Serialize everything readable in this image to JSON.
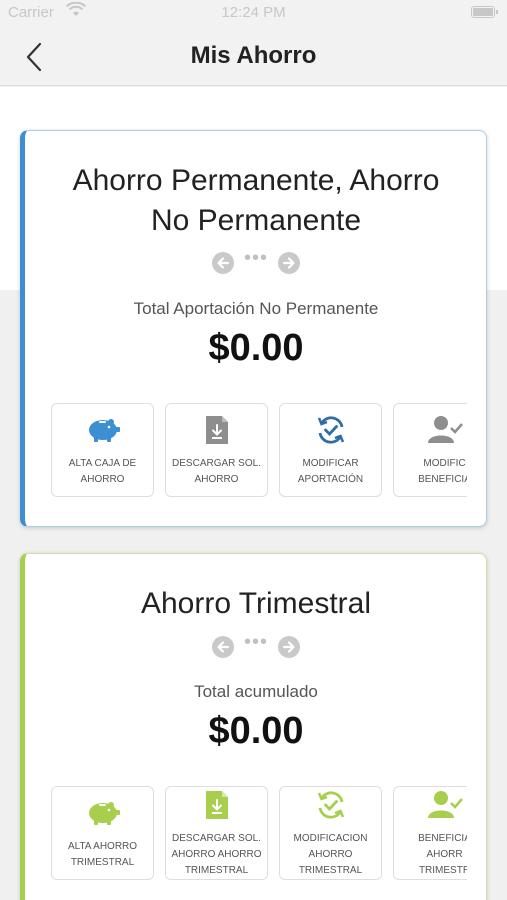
{
  "statusbar": {
    "carrier": "Carrier",
    "time": "12:24 PM"
  },
  "navbar": {
    "title": "Mis Ahorro"
  },
  "colors": {
    "blue_accent": "#3c8fd2",
    "green_accent": "#a7cf4d"
  },
  "cards": [
    {
      "title_line1": "Ahorro Permanente, Ahorro",
      "title_line2": "No Permanente",
      "label": "Total Aportación No Permanente",
      "amount": "$0.00",
      "actions": [
        {
          "icon": "piggy-bank-icon",
          "line1": "ALTA CAJA DE",
          "line2": "AHORRO",
          "line3": ""
        },
        {
          "icon": "download-document-icon",
          "line1": "DESCARGAR SOL.",
          "line2": "AHORRO",
          "line3": ""
        },
        {
          "icon": "refresh-check-icon",
          "line1": "MODIFICAR",
          "line2": "APORTACIÓN",
          "line3": ""
        },
        {
          "icon": "user-check-icon",
          "line1": "MODIFIC",
          "line2": "BENEFICIA",
          "line3": ""
        }
      ]
    },
    {
      "title_line1": "Ahorro Trimestral",
      "label": "Total acumulado",
      "amount": "$0.00",
      "actions": [
        {
          "icon": "piggy-bank-icon",
          "line1": "ALTA AHORRO",
          "line2": "TRIMESTRAL",
          "line3": ""
        },
        {
          "icon": "download-document-icon",
          "line1": "DESCARGAR SOL.",
          "line2": "AHORRO AHORRO",
          "line3": "TRIMESTRAL"
        },
        {
          "icon": "refresh-check-icon",
          "line1": "MODIFICACION",
          "line2": "AHORRO",
          "line3": "TRIMESTRAL"
        },
        {
          "icon": "user-check-icon",
          "line1": "BENEFICIA",
          "line2": "AHORR",
          "line3": "TRIMESTR"
        }
      ]
    }
  ]
}
